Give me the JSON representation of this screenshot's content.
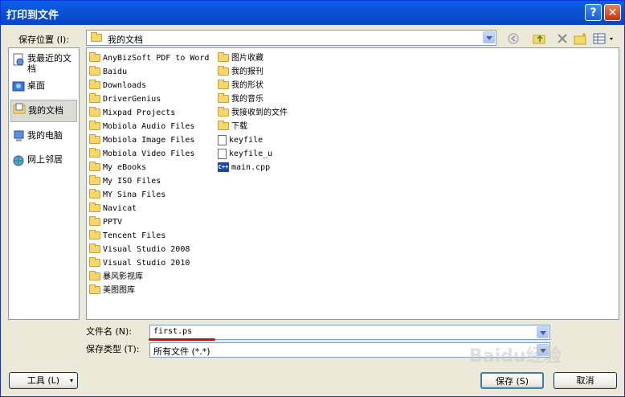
{
  "window": {
    "title": "打印到文件"
  },
  "title_buttons": {
    "help": "?",
    "close": "✕"
  },
  "save_in": {
    "label": "保存位置 (I):",
    "value": "我的文档"
  },
  "places": [
    {
      "label": "我最近的文档",
      "icon": "recent-docs-icon"
    },
    {
      "label": "桌面",
      "icon": "desktop-icon"
    },
    {
      "label": "我的文档",
      "icon": "my-documents-icon"
    },
    {
      "label": "我的电脑",
      "icon": "my-computer-icon"
    },
    {
      "label": "网上邻居",
      "icon": "network-icon"
    }
  ],
  "files_col1": [
    "AnyBizSoft PDF to Word",
    "Baidu",
    "Downloads",
    "DriverGenius",
    "Mixpad Projects",
    "Mobiola Audio Files",
    "Mobiola Image Files",
    "Mobiola Video Files",
    "My eBooks",
    "My ISO Files",
    "MY Sina Files",
    "Navicat",
    "PPTV",
    "Tencent Files",
    "Visual Studio 2008",
    "Visual Studio 2010",
    "暴风影视库",
    "美图图库"
  ],
  "files_col2": [
    {
      "name": "图片收藏",
      "type": "folder"
    },
    {
      "name": "我的报刊",
      "type": "folder"
    },
    {
      "name": "我的形状",
      "type": "folder"
    },
    {
      "name": "我的音乐",
      "type": "folder"
    },
    {
      "name": "我接收到的文件",
      "type": "folder"
    },
    {
      "name": "下载",
      "type": "folder"
    },
    {
      "name": "keyfile",
      "type": "file"
    },
    {
      "name": "keyfile_u",
      "type": "file"
    },
    {
      "name": "main.cpp",
      "type": "cpp"
    }
  ],
  "filename": {
    "label": "文件名 (N):",
    "value": "first.ps"
  },
  "filetype": {
    "label": "保存类型 (T):",
    "value": "所有文件 (*.*)"
  },
  "buttons": {
    "tools": "工具 (L)",
    "save": "保存 (S)",
    "cancel": "取消"
  },
  "watermark": "Baidu经验",
  "colors": {
    "titlebar": "#0a52d6",
    "annotation_underline": "#e00000"
  }
}
